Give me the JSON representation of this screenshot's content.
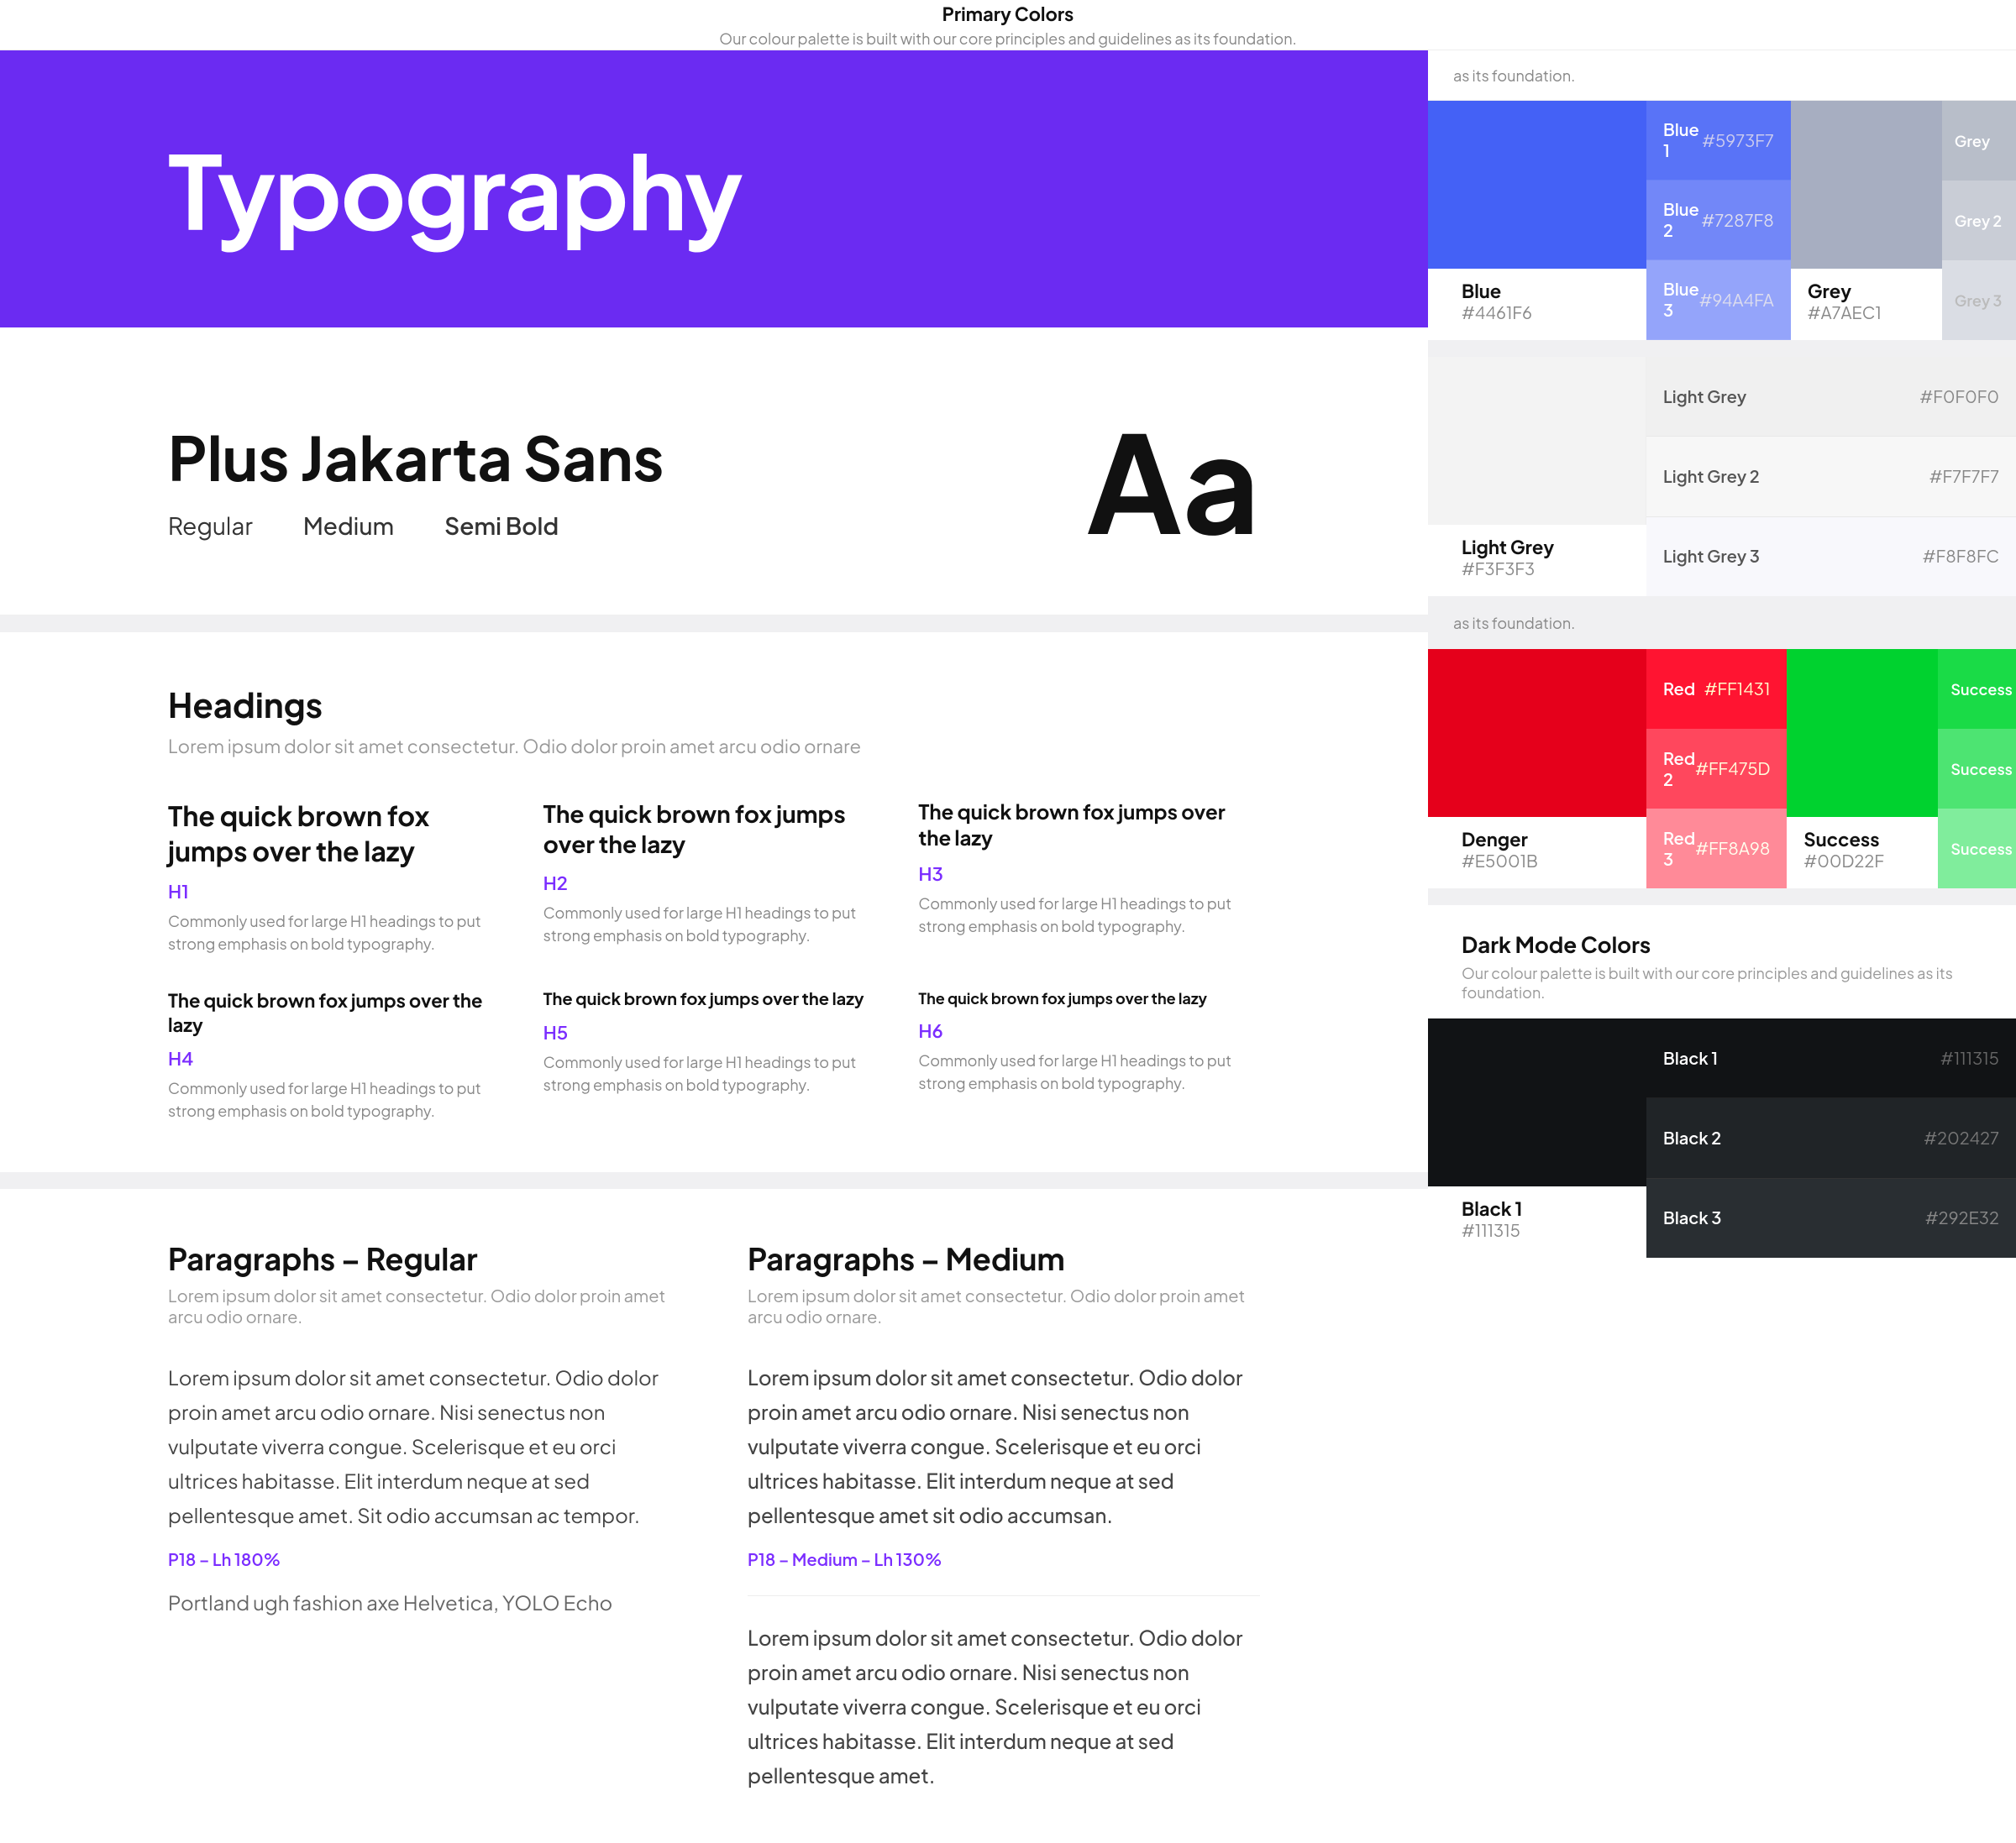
{
  "topbar": {
    "title": "Primary Colors",
    "desc": "Our colour palette is built with our core principles and guidelines as its foundation."
  },
  "hero": {
    "title": "Typography"
  },
  "font": {
    "name": "Plus Jakarta Sans",
    "weights": [
      "Regular",
      "Medium",
      "Semi Bold"
    ],
    "preview": "Aa"
  },
  "headings": {
    "title": "Headings",
    "desc": "Lorem ipsum dolor sit amet consectetur. Odio dolor proin amet arcu odio ornare",
    "items": [
      {
        "text": "The quick brown fox jumps over the lazy",
        "label": "H1",
        "desc": "Commonly used for large H1 headings to put strong emphasis on bold typography."
      },
      {
        "text": "The quick brown fox jumps over the lazy",
        "label": "H2",
        "desc": "Commonly used for large H1 headings to put strong emphasis on bold typography."
      },
      {
        "text": "The quick brown fox jumps over the lazy",
        "label": "H3",
        "desc": "Commonly used for large H1 headings to put strong emphasis on bold typography."
      },
      {
        "text": "The quick brown fox jumps over the lazy",
        "label": "H4",
        "desc": "Commonly used for large H1 headings to put strong emphasis on bold typography."
      },
      {
        "text": "The quick brown fox jumps over the lazy",
        "label": "H5",
        "desc": "Commonly used for large H1 headings to put strong emphasis on bold typography."
      },
      {
        "text": "The quick brown fox jumps over the lazy",
        "label": "H6",
        "desc": "Commonly used for large H1 headings to put strong emphasis on bold typography."
      }
    ]
  },
  "paragraphs": {
    "regular": {
      "title": "Paragraphs – Regular",
      "desc": "Lorem ipsum dolor sit amet consectetur. Odio dolor proin amet arcu odio ornare.",
      "body": "Lorem ipsum dolor sit amet consectetur. Odio dolor proin amet arcu odio ornare. Nisi senectus non vulputate viverra congue. Scelerisque et eu orci ultrices habitasse. Elit interdum neque at sed pellentesque amet. Sit odio accumsan ac tempor.",
      "label": "P18 – Lh 180%",
      "footer": "Portland ugh fashion axe Helvetica, YOLO Echo"
    },
    "medium": {
      "title": "Paragraphs – Medium",
      "desc": "Lorem ipsum dolor sit amet consectetur. Odio dolor proin amet arcu odio ornare.",
      "body1": "Lorem ipsum dolor sit amet consectetur. Odio dolor proin amet arcu odio ornare. Nisi senectus non vulputate viverra congue. Scelerisque et eu orci ultrices habitasse. Elit interdum neque at sed pellentesque amet sit odio accumsan.",
      "label": "P18 – Medium – Lh 130%",
      "body2": "Lorem ipsum dolor sit amet consectetur. Odio dolor proin amet arcu odio ornare. Nisi senectus non vulputate viverra congue. Scelerisque et eu orci ultrices habitasse. Elit interdum neque at sed pellentesque amet."
    }
  },
  "colors": {
    "sectionTitle": "Primary Colors",
    "sectionDesc": "Our colour palette is built with our core principles and guidelines as its foundation.",
    "blue": {
      "name": "Blue",
      "hex": "#4461F6",
      "shades": [
        {
          "name": "Blue 1",
          "hex": "#5973F7"
        },
        {
          "name": "Blue 2",
          "hex": "#7287F8"
        },
        {
          "name": "Blue 3",
          "hex": "#94A4FA"
        }
      ]
    },
    "grey": {
      "name": "Grey",
      "hex": "#A7AEC1",
      "shades": [
        {
          "name": "Grey",
          "hex": ""
        },
        {
          "name": "Grey 2",
          "hex": ""
        },
        {
          "name": "Grey 3",
          "hex": ""
        }
      ]
    },
    "lightGrey": {
      "name": "Light Grey",
      "hex": "#F3F3F3",
      "shades": [
        {
          "name": "Light Grey",
          "hex": "#F0F0F0"
        },
        {
          "name": "Light Grey 2",
          "hex": "#F7F7F7"
        },
        {
          "name": "Light Grey 3",
          "hex": "#F8F8FC"
        }
      ]
    },
    "danger": {
      "name": "Denger",
      "hex": "#E5001B",
      "shades": [
        {
          "name": "Red",
          "hex": "#FF1431"
        },
        {
          "name": "Red 2",
          "hex": "#FF475D"
        },
        {
          "name": "Red 3",
          "hex": "#FF8A98"
        }
      ]
    },
    "success": {
      "name": "Success",
      "hex": "#00D22F",
      "shades": [
        {
          "name": "Success",
          "hex": ""
        },
        {
          "name": "Success",
          "hex": ""
        },
        {
          "name": "Success",
          "hex": ""
        }
      ]
    },
    "darkMode": {
      "sectionTitle": "Dark Mode Colors",
      "sectionDesc": "Our colour palette is built with our core principles and guidelines as its foundation.",
      "name": "Black 1",
      "hex": "#111315",
      "shades": [
        {
          "name": "Black 1",
          "hex": "#111315"
        },
        {
          "name": "Black 2",
          "hex": "#202427"
        },
        {
          "name": "Black 3",
          "hex": "#292E32"
        }
      ]
    }
  }
}
